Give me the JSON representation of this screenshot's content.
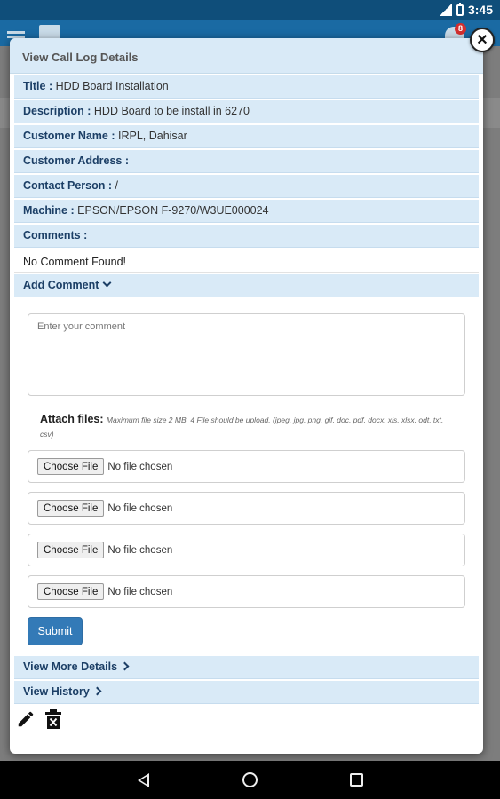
{
  "status_bar": {
    "time": "3:45"
  },
  "app_bar": {
    "notification_count": "8"
  },
  "modal": {
    "title": "View Call Log Details",
    "close_symbol": "✕",
    "fields": [
      {
        "label": "Title :",
        "value": "HDD Board Installation"
      },
      {
        "label": "Description :",
        "value": "HDD Board to be install in 6270"
      },
      {
        "label": "Customer Name :",
        "value": "IRPL, Dahisar"
      },
      {
        "label": "Customer Address :",
        "value": ""
      },
      {
        "label": "Contact Person :",
        "value": "/"
      },
      {
        "label": "Machine :",
        "value": "EPSON/EPSON F-9270/W3UE000024"
      },
      {
        "label": "Comments :",
        "value": ""
      }
    ],
    "no_comment_text": "No Comment Found!",
    "add_comment_label": "Add Comment",
    "comment_placeholder": "Enter your comment",
    "attach_label": "Attach files:",
    "attach_note": "Maximum file size 2 MB, 4 File should be upload.  (jpeg, jpg, png, gif, doc, pdf, docx, xls, xlsx, odt, txt, csv)",
    "file_inputs": [
      {
        "button": "Choose File",
        "status": "No file chosen"
      },
      {
        "button": "Choose File",
        "status": "No file chosen"
      },
      {
        "button": "Choose File",
        "status": "No file chosen"
      },
      {
        "button": "Choose File",
        "status": "No file chosen"
      }
    ],
    "submit_label": "Submit",
    "view_more_label": "View More Details",
    "view_history_label": "View History"
  },
  "icons": [
    "menu-icon",
    "brand-icon",
    "bell-icon",
    "close-icon",
    "chevron-down-icon",
    "chevron-right-icon",
    "edit-icon",
    "delete-icon",
    "back-icon",
    "home-icon",
    "recents-icon"
  ],
  "colors": {
    "status_bar": "#0f4e7a",
    "app_bar": "#1a6aa3",
    "row_bg": "#d9eaf7",
    "row_text": "#1c3f66",
    "submit": "#337ab7"
  }
}
